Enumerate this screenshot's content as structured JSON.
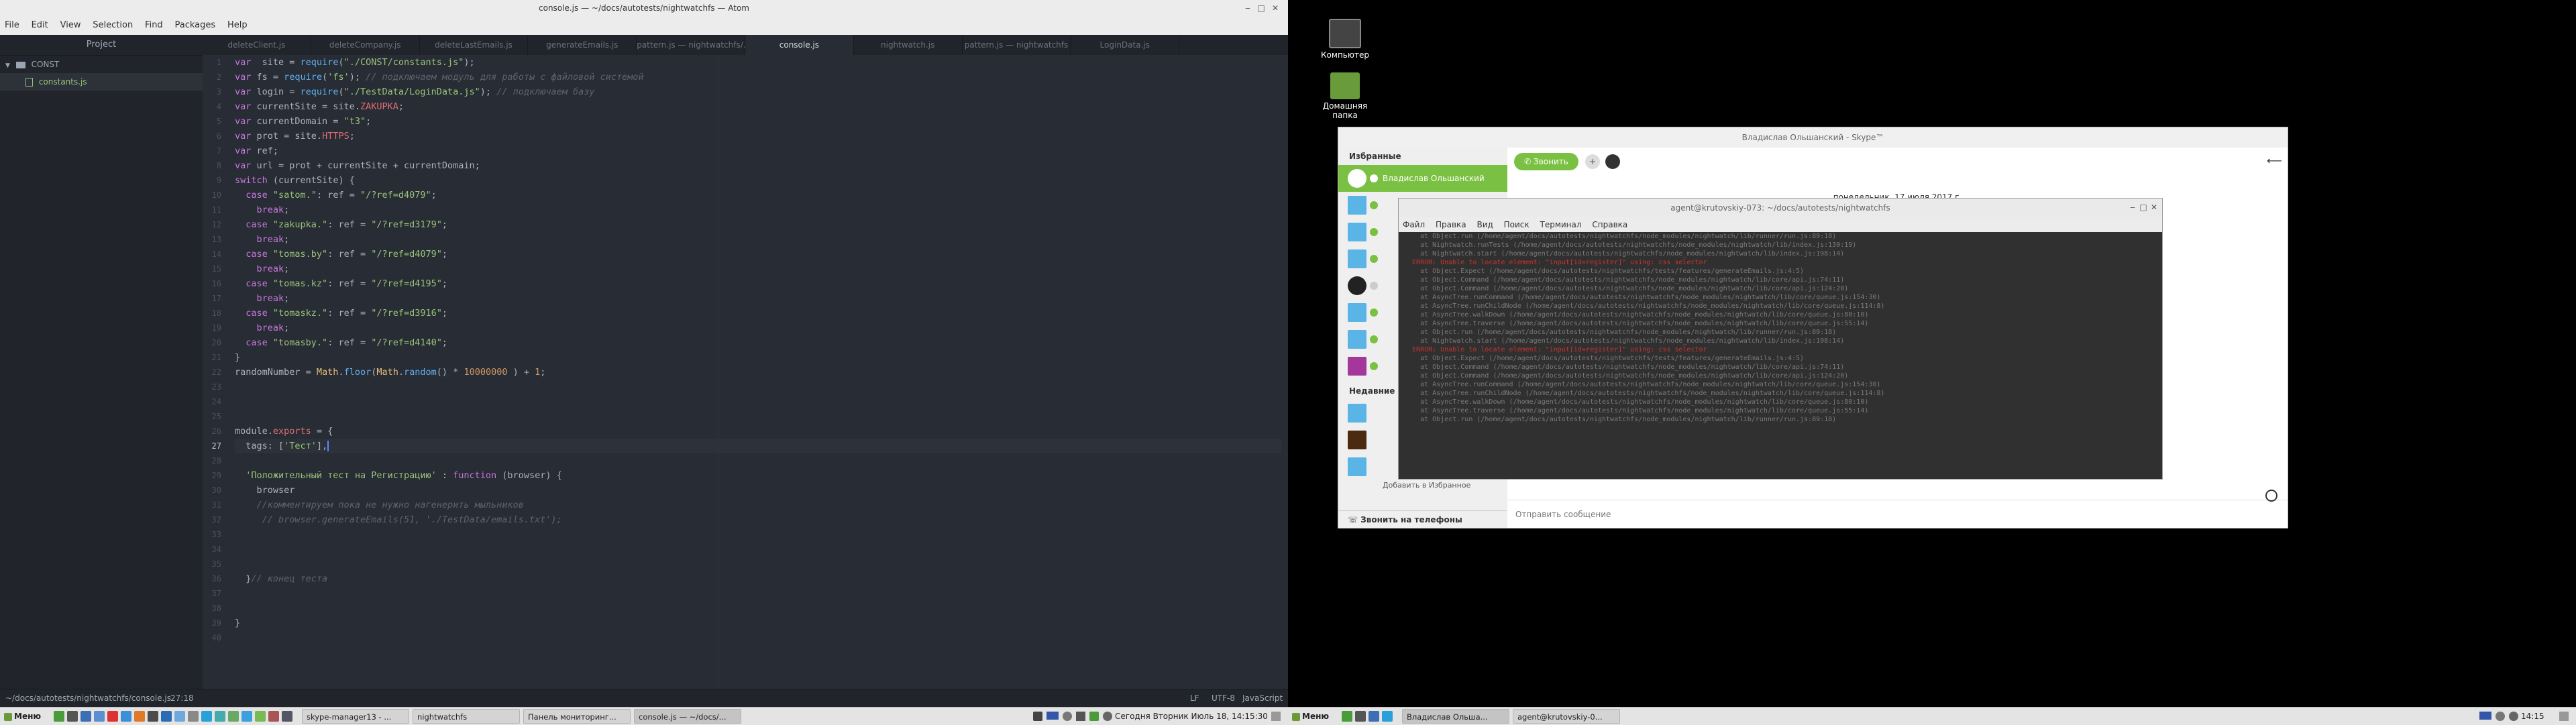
{
  "atom": {
    "title": "console.js — ~/docs/autotests/nightwatchfs — Atom",
    "menu": [
      "File",
      "Edit",
      "View",
      "Selection",
      "Find",
      "Packages",
      "Help"
    ],
    "tree_header": "Project",
    "tree_folder": "CONST",
    "tree_file": "constants.js",
    "tabs": [
      "deleteClient.js",
      "deleteCompany.js",
      "deleteLastEmails.js",
      "generateEmails.js",
      "pattern.js — nightwatchfs/...",
      "console.js",
      "nightwatch.js",
      "pattern.js — nightwatchfs",
      "LoginData.js"
    ],
    "active_tab": 5,
    "line_numbers": [
      "1",
      "2",
      "3",
      "4",
      "5",
      "6",
      "7",
      "8",
      "9",
      "10",
      "11",
      "12",
      "13",
      "14",
      "15",
      "16",
      "17",
      "18",
      "19",
      "20",
      "21",
      "22",
      "23",
      "24",
      "25",
      "26",
      "27",
      "28",
      "29",
      "30",
      "31",
      "32",
      "33",
      "34",
      "35",
      "36",
      "37",
      "38",
      "39",
      "40"
    ],
    "current_line": 27,
    "status": {
      "path": "~/docs/autotests/nightwatchfs/console.js",
      "cursor": "27:18",
      "line_ending": "LF",
      "encoding": "UTF-8",
      "grammar": "JavaScript"
    }
  },
  "code": [
    [
      [
        "kw",
        "var"
      ],
      [
        "",
        "  site = "
      ],
      [
        "fn",
        "require"
      ],
      [
        "",
        "("
      ],
      [
        "str",
        "\"./CONST/constants.js\""
      ],
      [
        "",
        ");"
      ]
    ],
    [
      [
        "kw",
        "var"
      ],
      [
        "",
        " fs = "
      ],
      [
        "fn",
        "require"
      ],
      [
        "",
        "("
      ],
      [
        "str",
        "'fs'"
      ],
      [
        "",
        "); "
      ],
      [
        "cm",
        "// подключаем модуль для работы с файловой системой"
      ]
    ],
    [
      [
        "kw",
        "var"
      ],
      [
        "",
        " login = "
      ],
      [
        "fn",
        "require"
      ],
      [
        "",
        "("
      ],
      [
        "str",
        "\"./TestData/LoginData.js\""
      ],
      [
        "",
        "); "
      ],
      [
        "cm",
        "// подключаем базу"
      ]
    ],
    [
      [
        "kw",
        "var"
      ],
      [
        "",
        " currentSite = site."
      ],
      [
        "prop",
        "ZAKUPKA"
      ],
      [
        "",
        ";"
      ]
    ],
    [
      [
        "kw",
        "var"
      ],
      [
        "",
        " currentDomain = "
      ],
      [
        "str",
        "\"t3\""
      ],
      [
        "",
        ";"
      ]
    ],
    [
      [
        "kw",
        "var"
      ],
      [
        "",
        " prot = site."
      ],
      [
        "prop",
        "HTTPS"
      ],
      [
        "",
        ";"
      ]
    ],
    [
      [
        "kw",
        "var"
      ],
      [
        "",
        " ref;"
      ]
    ],
    [
      [
        "kw",
        "var"
      ],
      [
        "",
        " url = prot + currentSite + currentDomain;"
      ]
    ],
    [
      [
        "kw",
        "switch"
      ],
      [
        "",
        " (currentSite) {"
      ]
    ],
    [
      [
        "",
        "  "
      ],
      [
        "kw",
        "case"
      ],
      [
        "",
        ""
      ],
      [
        "str",
        " \"satom.\""
      ],
      [
        "",
        ": ref = "
      ],
      [
        "str",
        "\"/?ref=d4079\""
      ],
      [
        "",
        ";"
      ]
    ],
    [
      [
        "",
        "    "
      ],
      [
        "kw",
        "break"
      ],
      [
        "",
        ";"
      ]
    ],
    [
      [
        "",
        "  "
      ],
      [
        "kw",
        "case"
      ],
      [
        "str",
        " \"zakupka.\""
      ],
      [
        "",
        ": ref = "
      ],
      [
        "str",
        "\"/?ref=d3179\""
      ],
      [
        "",
        ";"
      ]
    ],
    [
      [
        "",
        "    "
      ],
      [
        "kw",
        "break"
      ],
      [
        "",
        ";"
      ]
    ],
    [
      [
        "",
        "  "
      ],
      [
        "kw",
        "case"
      ],
      [
        "str",
        " \"tomas.by\""
      ],
      [
        "",
        ": ref = "
      ],
      [
        "str",
        "\"/?ref=d4079\""
      ],
      [
        "",
        ";"
      ]
    ],
    [
      [
        "",
        "    "
      ],
      [
        "kw",
        "break"
      ],
      [
        "",
        ";"
      ]
    ],
    [
      [
        "",
        "  "
      ],
      [
        "kw",
        "case"
      ],
      [
        "str",
        " \"tomas.kz\""
      ],
      [
        "",
        ": ref = "
      ],
      [
        "str",
        "\"/?ref=d4195\""
      ],
      [
        "",
        ";"
      ]
    ],
    [
      [
        "",
        "    "
      ],
      [
        "kw",
        "break"
      ],
      [
        "",
        ";"
      ]
    ],
    [
      [
        "",
        "  "
      ],
      [
        "kw",
        "case"
      ],
      [
        "str",
        " \"tomaskz.\""
      ],
      [
        "",
        ": ref = "
      ],
      [
        "str",
        "\"/?ref=d3916\""
      ],
      [
        "",
        ";"
      ]
    ],
    [
      [
        "",
        "    "
      ],
      [
        "kw",
        "break"
      ],
      [
        "",
        ";"
      ]
    ],
    [
      [
        "",
        "  "
      ],
      [
        "kw",
        "case"
      ],
      [
        "str",
        " \"tomasby.\""
      ],
      [
        "",
        ": ref = "
      ],
      [
        "str",
        "\"/?ref=d4140\""
      ],
      [
        "",
        ";"
      ]
    ],
    [
      [
        "",
        "}"
      ]
    ],
    [
      [
        "",
        "randomNumber = "
      ],
      [
        "cls",
        "Math"
      ],
      [
        "",
        "."
      ],
      [
        "fn",
        "floor"
      ],
      [
        "",
        "("
      ],
      [
        "cls",
        "Math"
      ],
      [
        "",
        "."
      ],
      [
        "fn",
        "random"
      ],
      [
        "",
        "() * "
      ],
      [
        "num",
        "10000000"
      ],
      [
        "",
        " ) + "
      ],
      [
        "num",
        "1"
      ],
      [
        "",
        ";"
      ]
    ],
    [],
    [],
    [],
    [
      [
        "",
        "module."
      ],
      [
        "prop",
        "exports"
      ],
      [
        "",
        " = {"
      ]
    ],
    [
      [
        "",
        "  tags: ["
      ],
      [
        "str",
        "'Тест'"
      ],
      [
        "",
        "],"
      ]
    ],
    [],
    [
      [
        "",
        "  "
      ],
      [
        "str",
        "'Положительный тест на Регистрацию'"
      ],
      [
        "",
        " : "
      ],
      [
        "kw",
        "function"
      ],
      [
        "",
        " (browser) {"
      ]
    ],
    [
      [
        "",
        "    browser"
      ]
    ],
    [
      [
        "",
        "    "
      ],
      [
        "cm",
        "//комментируем пока не нужно нагенерить мыльников"
      ]
    ],
    [
      [
        "",
        "     "
      ],
      [
        "cm",
        "// browser.generateEmails(51, './TestData/emails.txt');"
      ]
    ],
    [],
    [],
    [],
    [
      [
        "",
        "  }"
      ],
      [
        "cm",
        "// конец теста"
      ]
    ],
    [],
    [],
    [
      [
        "",
        "}"
      ]
    ],
    []
  ],
  "taskbar_left": {
    "menu_label": "Меню",
    "windows": [
      "skype-manager13 - ...",
      "nightwatchfs",
      "Панель мониторинг...",
      "console.js — ~/docs/..."
    ],
    "clock": "Сегодня Вторник Июль 18, 14:15:30"
  },
  "desktop": {
    "icons": [
      "Компьютер",
      "Домашняя папка"
    ]
  },
  "skype": {
    "title": "Владислав Ольшанский - Skype™",
    "favorites_header": "Избранные",
    "first_contact": "Владислав Ольшанский",
    "recent_header": "Недавние",
    "call_phones": "Звонить на телефоны",
    "call_button": "Звонить",
    "date": "понедельник, 17 июля 2017 г.",
    "message_placeholder": "Отправить сообщение",
    "add_to_favorites": "Добавить в Избранное"
  },
  "terminal": {
    "title": "agent@krutovskiy-073: ~/docs/autotests/nightwatchfs",
    "menu": [
      "Файл",
      "Правка",
      "Вид",
      "Поиск",
      "Терминал",
      "Справка"
    ],
    "lines": [
      {
        "t": "    at Object.run (/home/agent/docs/autotests/nightwatchfs/node_modules/nightwatch/lib/runner/run.js:89:18)",
        "red": false
      },
      {
        "t": "    at Nightwatch.runTests (/home/agent/docs/autotests/nightwatchfs/node_modules/nightwatch/lib/index.js:130:19)",
        "red": false
      },
      {
        "t": "    at Nightwatch.start (/home/agent/docs/autotests/nightwatchfs/node_modules/nightwatch/lib/index.js:198:14)",
        "red": false
      },
      {
        "t": "  ERROR: Unable to locate element: \"input[id=register]\" using: css selector",
        "red": true
      },
      {
        "t": "    at Object.Expect (/home/agent/docs/autotests/nightwatchfs/tests/features/generateEmails.js:4:5)",
        "red": false
      },
      {
        "t": "    at Object.Command (/home/agent/docs/autotests/nightwatchfs/node_modules/nightwatch/lib/core/api.js:74:11)",
        "red": false
      },
      {
        "t": "    at Object.Command (/home/agent/docs/autotests/nightwatchfs/node_modules/nightwatch/lib/core/api.js:124:20)",
        "red": false
      },
      {
        "t": "    at AsyncTree.runCommand (/home/agent/docs/autotests/nightwatchfs/node_modules/nightwatch/lib/core/queue.js:154:30)",
        "red": false
      },
      {
        "t": "    at AsyncTree.runChildNode (/home/agent/docs/autotests/nightwatchfs/node_modules/nightwatch/lib/core/queue.js:114:8)",
        "red": false
      },
      {
        "t": "    at AsyncTree.walkDown (/home/agent/docs/autotests/nightwatchfs/node_modules/nightwatch/lib/core/queue.js:80:10)",
        "red": false
      },
      {
        "t": "    at AsyncTree.traverse (/home/agent/docs/autotests/nightwatchfs/node_modules/nightwatch/lib/core/queue.js:55:14)",
        "red": false
      },
      {
        "t": "    at Object.run (/home/agent/docs/autotests/nightwatchfs/node_modules/nightwatch/lib/runner/run.js:89:18)",
        "red": false
      },
      {
        "t": "    at Nightwatch.start (/home/agent/docs/autotests/nightwatchfs/node_modules/nightwatch/lib/index.js:198:14)",
        "red": false
      },
      {
        "t": "  ERROR: Unable to locate element: \"input[id=register]\" using: css selector",
        "red": true
      },
      {
        "t": "    at Object.Expect (/home/agent/docs/autotests/nightwatchfs/tests/features/generateEmails.js:4:5)",
        "red": false
      },
      {
        "t": "    at Object.Command (/home/agent/docs/autotests/nightwatchfs/node_modules/nightwatch/lib/core/api.js:74:11)",
        "red": false
      },
      {
        "t": "    at Object.Command (/home/agent/docs/autotests/nightwatchfs/node_modules/nightwatch/lib/core/api.js:124:20)",
        "red": false
      },
      {
        "t": "    at AsyncTree.runCommand (/home/agent/docs/autotests/nightwatchfs/node_modules/nightwatch/lib/core/queue.js:154:30)",
        "red": false
      },
      {
        "t": "    at AsyncTree.runChildNode (/home/agent/docs/autotests/nightwatchfs/node_modules/nightwatch/lib/core/queue.js:114:8)",
        "red": false
      },
      {
        "t": "    at AsyncTree.walkDown (/home/agent/docs/autotests/nightwatchfs/node_modules/nightwatch/lib/core/queue.js:80:10)",
        "red": false
      },
      {
        "t": "    at AsyncTree.traverse (/home/agent/docs/autotests/nightwatchfs/node_modules/nightwatch/lib/core/queue.js:55:14)",
        "red": false
      },
      {
        "t": "    at Object.run (/home/agent/docs/autotests/nightwatchfs/node_modules/nightwatch/lib/runner/run.js:89:18)",
        "red": false
      }
    ]
  },
  "taskbar_right": {
    "menu_label": "Меню",
    "windows": [
      "Владислав Ольша...",
      "agent@krutovskiy-0..."
    ],
    "clock": "14:15"
  },
  "colors": {
    "atom_bg": "#282c34",
    "keyword": "#c678dd",
    "string": "#98c379",
    "comment": "#5c6370",
    "skype_green": "#7ac143",
    "error_red": "#cc3333"
  }
}
